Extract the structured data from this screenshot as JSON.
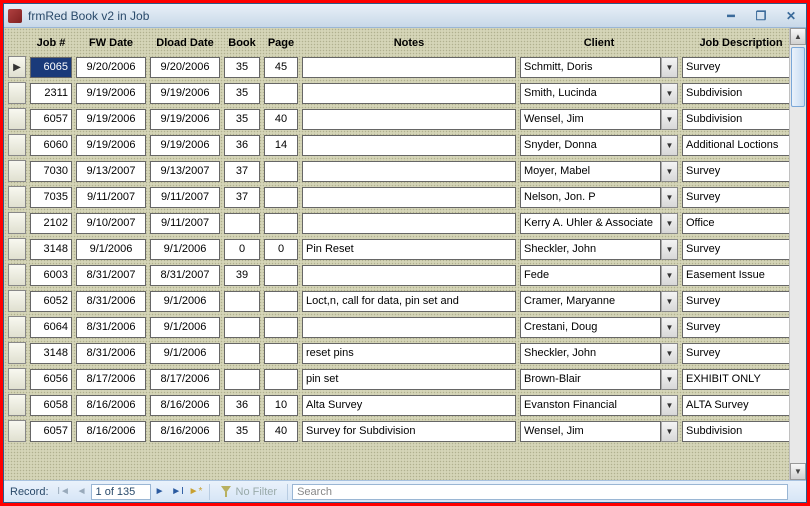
{
  "window": {
    "title": "frmRed Book v2 in Job"
  },
  "columns": {
    "job": "Job #",
    "fw": "FW Date",
    "dload": "Dload Date",
    "book": "Book",
    "page": "Page",
    "notes": "Notes",
    "client": "Client",
    "desc": "Job Description"
  },
  "rows": [
    {
      "job": "6065",
      "fw": "9/20/2006",
      "dl": "9/20/2006",
      "book": "35",
      "page": "45",
      "notes": "",
      "client": "Schmitt, Doris",
      "desc": "Survey",
      "selected": true,
      "current": true
    },
    {
      "job": "2311",
      "fw": "9/19/2006",
      "dl": "9/19/2006",
      "book": "35",
      "page": "",
      "notes": "",
      "client": "Smith, Lucinda",
      "desc": "Subdivision"
    },
    {
      "job": "6057",
      "fw": "9/19/2006",
      "dl": "9/19/2006",
      "book": "35",
      "page": "40",
      "notes": "",
      "client": "Wensel, Jim",
      "desc": "Subdivision"
    },
    {
      "job": "6060",
      "fw": "9/19/2006",
      "dl": "9/19/2006",
      "book": "36",
      "page": "14",
      "notes": "",
      "client": "Snyder, Donna",
      "desc": "Additional Loctions"
    },
    {
      "job": "7030",
      "fw": "9/13/2007",
      "dl": "9/13/2007",
      "book": "37",
      "page": "",
      "notes": "",
      "client": "Moyer, Mabel",
      "desc": "Survey"
    },
    {
      "job": "7035",
      "fw": "9/11/2007",
      "dl": "9/11/2007",
      "book": "37",
      "page": "",
      "notes": "",
      "client": "Nelson, Jon. P",
      "desc": "Survey"
    },
    {
      "job": "2102",
      "fw": "9/10/2007",
      "dl": "9/11/2007",
      "book": "",
      "page": "",
      "notes": "",
      "client": "Kerry A. Uhler & Associate",
      "desc": "Office"
    },
    {
      "job": "3148",
      "fw": "9/1/2006",
      "dl": "9/1/2006",
      "book": "0",
      "page": "0",
      "notes": "Pin Reset",
      "client": "Sheckler, John",
      "desc": "Survey"
    },
    {
      "job": "6003",
      "fw": "8/31/2007",
      "dl": "8/31/2007",
      "book": "39",
      "page": "",
      "notes": "",
      "client": "Fede",
      "desc": "Easement Issue"
    },
    {
      "job": "6052",
      "fw": "8/31/2006",
      "dl": "9/1/2006",
      "book": "",
      "page": "",
      "notes": "Loct,n, call for data, pin set and",
      "client": "Cramer, Maryanne",
      "desc": "Survey"
    },
    {
      "job": "6064",
      "fw": "8/31/2006",
      "dl": "9/1/2006",
      "book": "",
      "page": "",
      "notes": "",
      "client": "Crestani, Doug",
      "desc": "Survey"
    },
    {
      "job": "3148",
      "fw": "8/31/2006",
      "dl": "9/1/2006",
      "book": "",
      "page": "",
      "notes": "reset pins",
      "client": "Sheckler, John",
      "desc": "Survey"
    },
    {
      "job": "6056",
      "fw": "8/17/2006",
      "dl": "8/17/2006",
      "book": "",
      "page": "",
      "notes": "pin set",
      "client": "Brown-Blair",
      "desc": "EXHIBIT ONLY"
    },
    {
      "job": "6058",
      "fw": "8/16/2006",
      "dl": "8/16/2006",
      "book": "36",
      "page": "10",
      "notes": "Alta Survey",
      "client": "Evanston Financial",
      "desc": "ALTA Survey"
    },
    {
      "job": "6057",
      "fw": "8/16/2006",
      "dl": "8/16/2006",
      "book": "35",
      "page": "40",
      "notes": "Survey for Subdivision",
      "client": "Wensel, Jim",
      "desc": "Subdivision"
    }
  ],
  "nav": {
    "label": "Record:",
    "position": "1 of 135",
    "filter_label": "No Filter",
    "search_placeholder": "Search"
  }
}
